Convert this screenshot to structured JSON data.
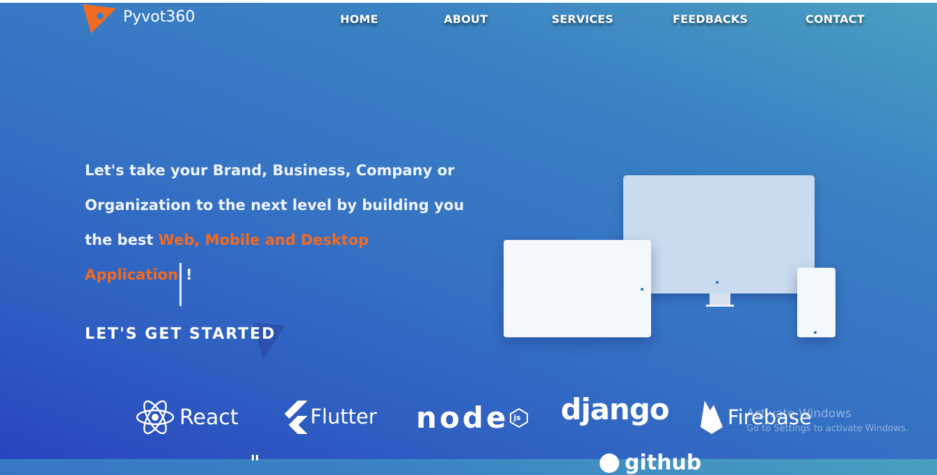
{
  "brand": {
    "name": "Pyvot360"
  },
  "nav": {
    "items": [
      "HOME",
      "ABOUT",
      "SERVICES",
      "FEEDBACKS",
      "CONTACT"
    ]
  },
  "hero": {
    "line1": "Let's take your Brand, Business, Company or",
    "line2": "Organization to the next level by building you",
    "line3_prefix": "the best ",
    "highlight1": "Web, Mobile and Desktop",
    "highlight2": "Application",
    "suffix": "!",
    "cta": "LET'S GET STARTED"
  },
  "technologies": [
    "React",
    "Flutter",
    "node",
    "js",
    "django",
    "Firebase",
    "github"
  ],
  "os_watermark": {
    "title": "Activate Windows",
    "subtitle": "Go to Settings to activate Windows."
  },
  "colors": {
    "accent": "#f26b21",
    "background_start": "#4aa0c0",
    "background_end": "#2845bd"
  }
}
